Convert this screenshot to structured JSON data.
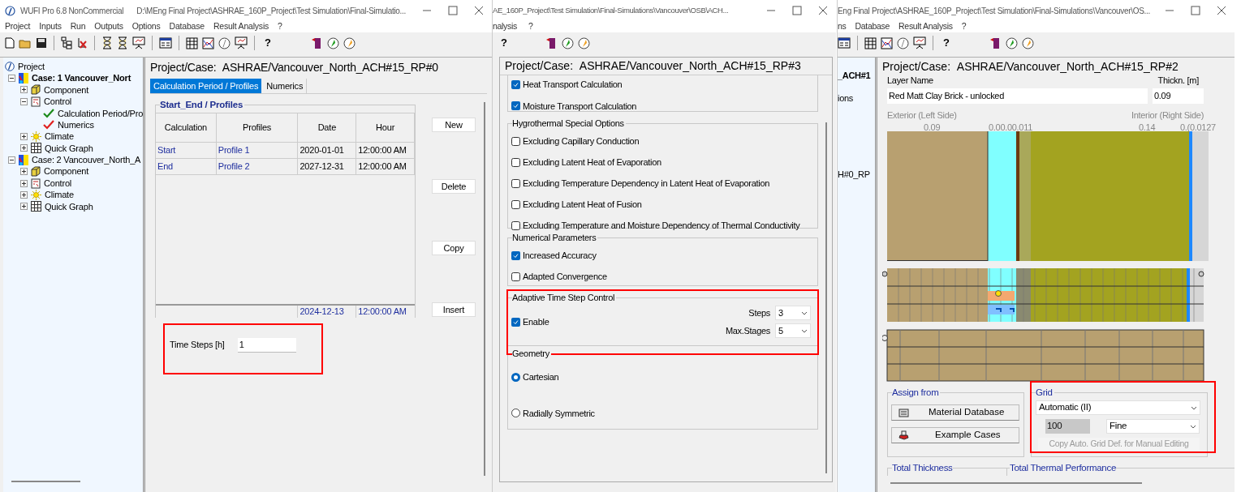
{
  "left_window": {
    "title_bar": {
      "app_name": "WUFI Pro 6.8 NonCommercial",
      "path": "D:\\MEng Final Project\\ASHRAE_160P_Project\\Test Simulation\\Final-Simulatio..."
    },
    "menu": [
      "Project",
      "Inputs",
      "Run",
      "Outputs",
      "Options",
      "Database",
      "Result Analysis",
      "?"
    ],
    "toolbar_help": "?",
    "tree": [
      {
        "kind": "project",
        "label": "Project",
        "children": [
          {
            "kind": "case",
            "label": "Case: 1 Vancouver_Nort",
            "active": true,
            "expanded": true,
            "children": [
              {
                "kind": "component",
                "label": "Component",
                "expanded": false
              },
              {
                "kind": "control",
                "label": "Control",
                "expanded": true,
                "children": [
                  {
                    "kind": "check",
                    "label": "Calculation Period/Pro",
                    "color": "#1a8a1a"
                  },
                  {
                    "kind": "check",
                    "label": "Numerics",
                    "color": "#e02020"
                  }
                ]
              },
              {
                "kind": "climate",
                "label": "Climate",
                "expanded": false
              },
              {
                "kind": "graph",
                "label": "Quick Graph",
                "expanded": false
              }
            ]
          },
          {
            "kind": "case",
            "label": "Case: 2 Vancouver_North_A",
            "active": false,
            "expanded": true,
            "children": [
              {
                "kind": "component",
                "label": "Component",
                "expanded": false
              },
              {
                "kind": "control",
                "label": "Control",
                "expanded": false
              },
              {
                "kind": "climate",
                "label": "Climate",
                "expanded": false
              },
              {
                "kind": "graph",
                "label": "Quick Graph",
                "expanded": false
              }
            ]
          }
        ]
      }
    ],
    "header": {
      "label": "Project/Case:",
      "value": "ASHRAE/Vancouver_North_ACH#15_RP#0"
    },
    "tabs": [
      {
        "label": "Calculation Period / Profiles",
        "selected": true
      },
      {
        "label": "Numerics",
        "selected": false
      }
    ],
    "profiles": {
      "title": "Start_End / Profiles",
      "columns": [
        "Calculation",
        "Profiles",
        "Date",
        "Hour"
      ],
      "rows": [
        [
          "Start",
          "Profile 1",
          "2020-01-01",
          "12:00:00 AM"
        ],
        [
          "End",
          "Profile 2",
          "2027-12-31",
          "12:00:00 AM"
        ]
      ],
      "footer": {
        "date": "2024-12-13",
        "hour": "12:00:00 AM"
      }
    },
    "buttons": [
      "New",
      "Delete",
      "Copy",
      "Insert"
    ],
    "time_steps": {
      "label": "Time Steps [h]",
      "value": "1"
    }
  },
  "middle_window": {
    "title_bar": {
      "path": "AE_160P_Project\\Test Simulation\\Final-Simulations\\Vancouver\\OSB\\ACH..."
    },
    "menu": [
      "nalysis",
      "?"
    ],
    "toolbar_help": "?",
    "header": {
      "label": "Project/Case:",
      "value": "ASHRAE/Vancouver_North_ACH#15_RP#3"
    },
    "transport": {
      "options": [
        {
          "label": "Heat Transport Calculation",
          "checked": true
        },
        {
          "label": "Moisture Transport Calculation",
          "checked": true
        }
      ]
    },
    "special_options": {
      "title": "Hygrothermal Special Options",
      "options": [
        {
          "label": "Excluding Capillary Conduction",
          "checked": false
        },
        {
          "label": "Excluding Latent Heat of Evaporation",
          "checked": false
        },
        {
          "label": "Excluding Temperature Dependency in Latent Heat of Evaporation",
          "checked": false
        },
        {
          "label": "Excluding Latent Heat of Fusion",
          "checked": false
        },
        {
          "label": "Excluding Temperature and Moisture Dependency of Thermal Conductivity",
          "checked": false
        }
      ]
    },
    "numerical": {
      "title": "Numerical Parameters",
      "options": [
        {
          "label": "Increased Accuracy",
          "checked": true
        },
        {
          "label": "Adapted Convergence",
          "checked": false
        }
      ]
    },
    "adaptive": {
      "title": "Adaptive Time Step Control",
      "enable": {
        "label": "Enable",
        "checked": true
      },
      "steps": {
        "label": "Steps",
        "value": "3"
      },
      "max_stages": {
        "label": "Max.Stages",
        "value": "5"
      }
    },
    "geometry": {
      "title": "Geometry",
      "options": [
        {
          "label": "Cartesian",
          "selected": true
        },
        {
          "label": "Radially Symmetric",
          "selected": false
        }
      ]
    }
  },
  "right_window": {
    "title_bar": {
      "path": "Eng Final Project\\ASHRAE_160P_Project\\Test Simulation\\Final-Simulations\\Vancouver\\OS..."
    },
    "menu": [
      "ns",
      "Database",
      "Result Analysis",
      "?"
    ],
    "toolbar_help": "?",
    "tree_fragments": [
      {
        "label": "_ACH#1",
        "bold": true
      },
      {
        "label": "ions",
        "bold": false
      },
      {
        "label": "H#0_RP",
        "bold": false
      }
    ],
    "header": {
      "label": "Project/Case:",
      "value": "ASHRAE/Vancouver_North_ACH#15_RP#2"
    },
    "layer_name": {
      "label": "Layer Name",
      "value": "Red Matt Clay Brick - unlocked"
    },
    "thickness": {
      "label": "Thickn. [m]",
      "value": "0.09"
    },
    "exterior_label": "Exterior (Left Side)",
    "interior_label": "Interior (Right Side)",
    "scale_labels": [
      "0.09",
      "0.00.00.011",
      "0.14",
      "0.(0.0127"
    ],
    "assign_from": {
      "title": "Assign from",
      "buttons": [
        {
          "kind": "database",
          "label": "Material Database"
        },
        {
          "kind": "examples",
          "label": "Example Cases"
        }
      ]
    },
    "grid": {
      "title": "Grid",
      "mode": "Automatic (II)",
      "count": {
        "value": "100",
        "disabled": true
      },
      "resolution": "Fine",
      "copy_button": {
        "label": "Copy Auto. Grid Def. for Manual Editing",
        "disabled": true
      }
    },
    "total_thickness": "Total Thickness",
    "total_thermal": "Total Thermal Performance"
  }
}
